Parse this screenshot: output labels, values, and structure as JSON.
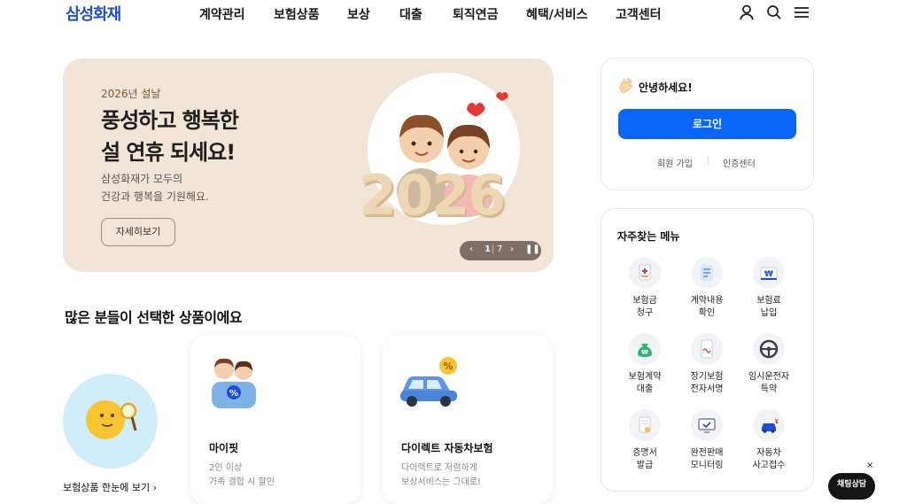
{
  "header": {
    "logo": "삼성화재",
    "nav": [
      "계약관리",
      "보험상품",
      "보상",
      "대출",
      "퇴직연금",
      "혜택/서비스",
      "고객센터"
    ],
    "icons": [
      "user-icon",
      "search-icon",
      "menu-icon"
    ]
  },
  "banner": {
    "year_label": "2026년 설날",
    "title": "풍성하고 행복한\n설 연휴 되세요!",
    "desc": "삼성화재가 모두의\n건강과 행복을 기원해요.",
    "button": "자세히보기",
    "art_number": "2026",
    "pager": {
      "current": "1",
      "total": "7"
    }
  },
  "login": {
    "greeting": "안녕하세요!",
    "button": "로그인",
    "links": [
      "회원 가입",
      "인증센터"
    ]
  },
  "quick_menu": {
    "title": "자주찾는 메뉴",
    "items": [
      {
        "label": "보험금\n청구",
        "icon": "insurance-claim-icon"
      },
      {
        "label": "계약내용\n확인",
        "icon": "contract-document-icon"
      },
      {
        "label": "보험료\n납입",
        "icon": "won-payment-icon"
      },
      {
        "label": "보험계약\n대출",
        "icon": "money-bag-icon"
      },
      {
        "label": "장기보험\n전자서명",
        "icon": "mobile-sign-icon"
      },
      {
        "label": "임시운전자\n특약",
        "icon": "steering-wheel-icon"
      },
      {
        "label": "증명서\n발급",
        "icon": "certificate-icon"
      },
      {
        "label": "완전판매\n모니터링",
        "icon": "monitor-check-icon"
      },
      {
        "label": "자동차\n사고접수",
        "icon": "car-accident-icon"
      }
    ]
  },
  "products": {
    "title": "많은 분들이 선택한 상품이에요",
    "all_link": "보험상품 한눈에 보기",
    "cards": [
      {
        "name": "마이핏",
        "desc": "2인 이상\n가족 결합 시 할인"
      },
      {
        "name": "다이렉트 자동차보험",
        "desc": "다이렉트로 저렴하게\n보상서비스는 그대로!"
      }
    ]
  },
  "chat": {
    "label": "채팅상담",
    "close": "×"
  },
  "colors": {
    "brand": "#1d4ed8",
    "login_button": "#0a66f4",
    "banner_bg": "#f1e5d7"
  }
}
